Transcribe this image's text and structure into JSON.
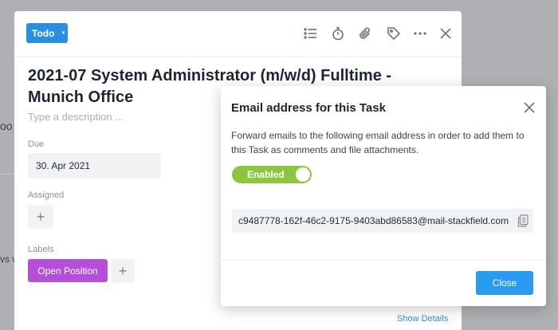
{
  "background": {
    "partial_text_1": "oo",
    "partial_text_2": "vs w"
  },
  "task": {
    "status_label": "Todo",
    "title": "2021-07 System Administrator (m/w/d) Fulltime - Munich Office",
    "description_placeholder": "Type a description ...",
    "due_label": "Due",
    "due_value": "30. Apr 2021",
    "assigned_label": "Assigned",
    "labels_label": "Labels",
    "label_chip": "Open Position",
    "plus_symbol": "+",
    "show_details": "Show Details",
    "toolbar_icons": [
      "checklist-icon",
      "timer-icon",
      "attachment-icon",
      "tag-icon",
      "more-icon",
      "close-icon"
    ]
  },
  "dialog": {
    "title": "Email address for this Task",
    "body": "Forward emails to the following email address in order to add them to this Task as comments and file attachments.",
    "toggle_label": "Enabled",
    "email": "c9487778-162f-46c2-9175-9403abd86583@mail-stackfield.com",
    "close_button": "Close"
  },
  "colors": {
    "primary_blue": "#2a8fe0",
    "label_purple": "#b450d8",
    "toggle_green": "#8cc63f",
    "backdrop": "#aeb0b3"
  }
}
